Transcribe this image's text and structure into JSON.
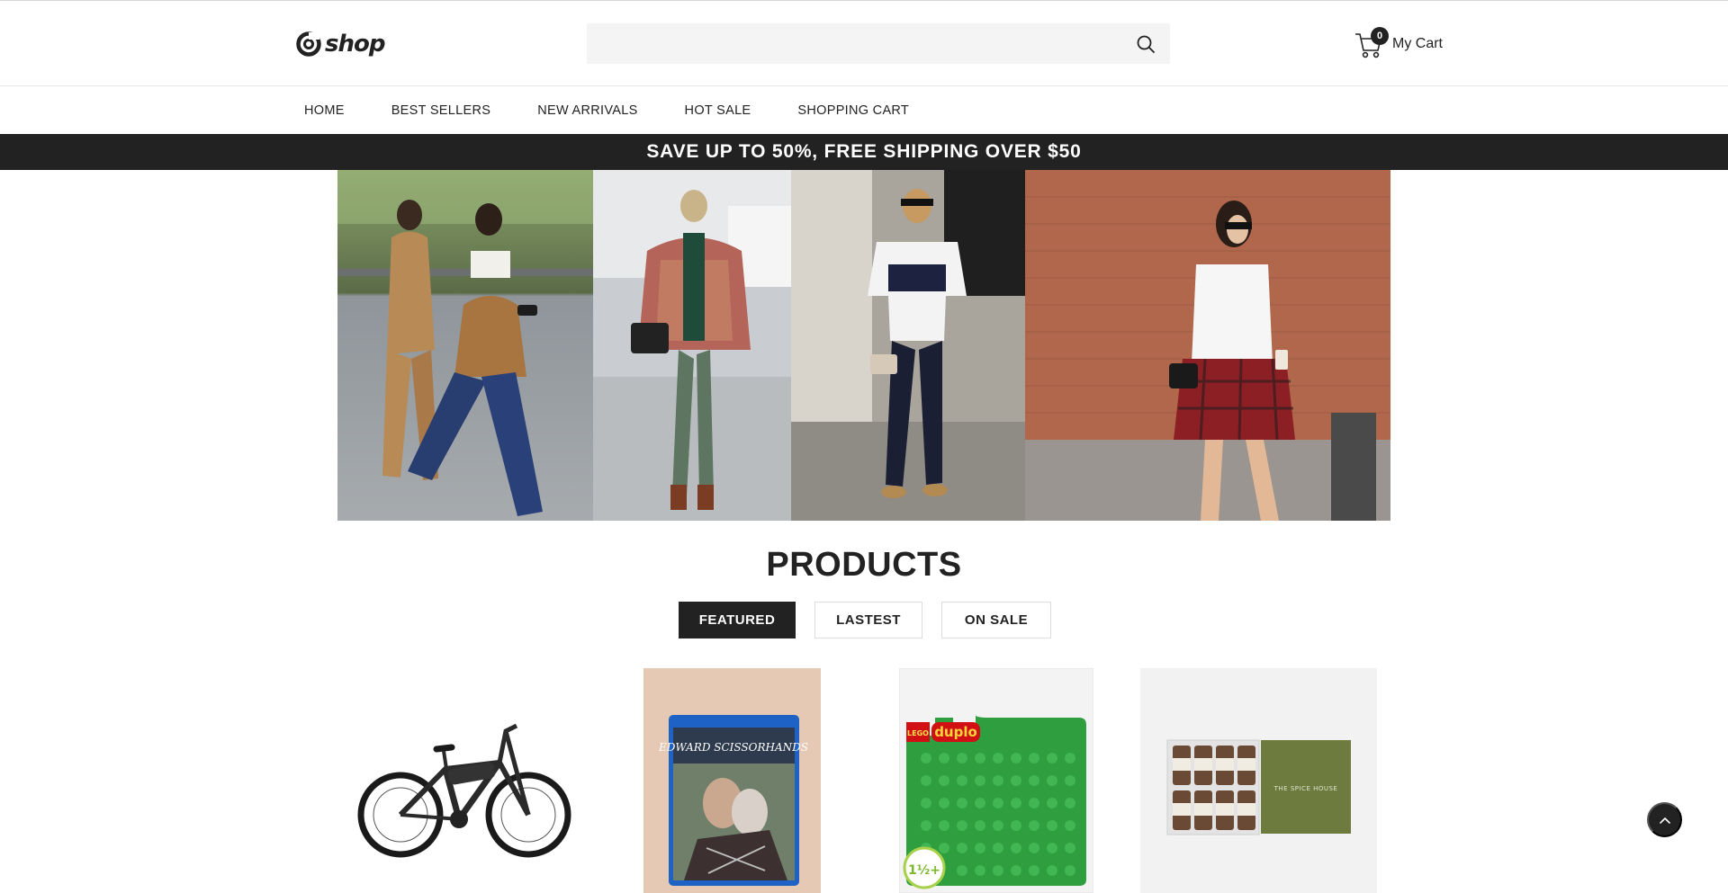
{
  "header": {
    "logo_text": "shop",
    "search": {
      "value": "",
      "placeholder": ""
    },
    "cart": {
      "count": "0",
      "label": "My Cart"
    }
  },
  "nav": {
    "items": [
      {
        "label": "HOME"
      },
      {
        "label": "BEST SELLERS"
      },
      {
        "label": "NEW ARRIVALS"
      },
      {
        "label": "HOT SALE"
      },
      {
        "label": "SHOPPING CART"
      }
    ]
  },
  "promo": {
    "text": "SAVE UP TO 50%, FREE SHIPPING OVER $50"
  },
  "products": {
    "title": "PRODUCTS",
    "tabs": [
      {
        "label": "FEATURED",
        "active": true
      },
      {
        "label": "LASTEST",
        "active": false
      },
      {
        "label": "ON SALE",
        "active": false
      }
    ],
    "items": [
      {
        "image": "electric-mountain-bike"
      },
      {
        "image": "edward-scissorhands-bluray",
        "cover_text": "EDWARD SCISSORHANDS"
      },
      {
        "image": "lego-duplo-green-building-plate",
        "brand_text": "duplo",
        "age_text": "1½+"
      },
      {
        "image": "spice-house-gift-box",
        "box_text": "THE SPICE HOUSE"
      }
    ]
  },
  "colors": {
    "dark": "#222222",
    "search_bg": "#f4f4f4",
    "border": "#e6e6e6"
  },
  "icons": {
    "search": "search-icon",
    "cart": "cart-icon",
    "back_to_top": "chevron-up-icon"
  }
}
